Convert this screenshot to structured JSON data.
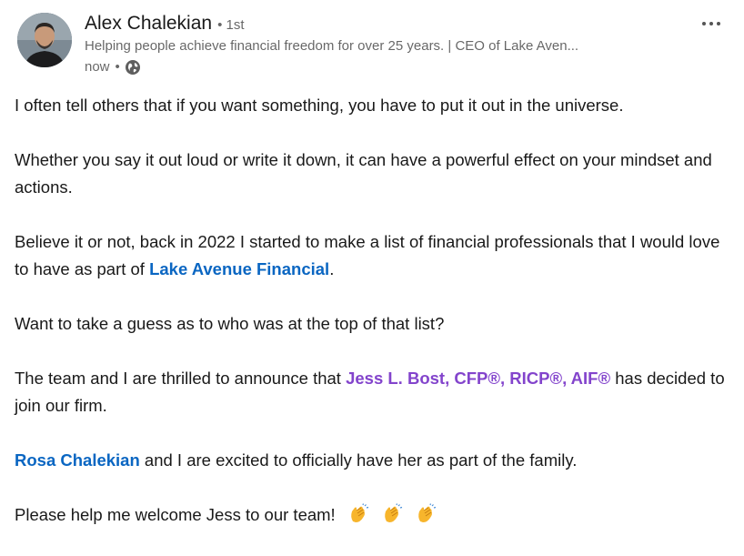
{
  "author": {
    "name": "Alex Chalekian",
    "degree": "1st",
    "headline": "Helping people achieve financial freedom for over 25 years. | CEO of Lake Aven...",
    "timestamp": "now",
    "visibility_icon": "globe-icon"
  },
  "menu": {
    "icon": "more-options-icon"
  },
  "post": {
    "p1": "I often tell others that if you want something, you have to put it out in the universe.",
    "p2": "Whether you say it out loud or write it down, it can have a powerful effect on your mindset and actions.",
    "p3_before": "Believe it or not, back in 2022 I started to make a list of financial professionals that I would love to have as part of ",
    "p3_link": "Lake Avenue Financial",
    "p3_after": ".",
    "p4": "Want to take a guess as to who was at the top of that list?",
    "p5_before": "The team and I are thrilled to announce that ",
    "p5_mention": "Jess L. Bost, CFP®, RICP®, AIF®",
    "p5_after": " has decided to join our firm.",
    "p6_mention": "Rosa Chalekian",
    "p6_after": " and I are excited to officially have her as part of the family.",
    "p7": "Please help me welcome Jess to our team!",
    "emoji_icon": "clapping-hands-icon"
  },
  "colors": {
    "link": "#0a66c2",
    "mention": "#8344cc",
    "secondary_text": "#666666"
  }
}
